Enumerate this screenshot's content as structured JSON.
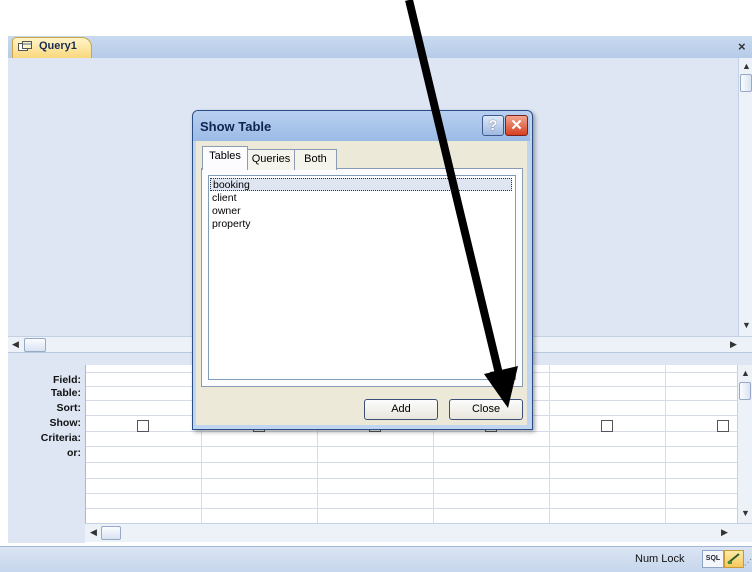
{
  "document": {
    "tab_label": "Query1",
    "close_glyph": "×"
  },
  "grid": {
    "row_labels": [
      "Field:",
      "Table:",
      "Sort:",
      "Show:",
      "Criteria:",
      "or:"
    ]
  },
  "status_bar": {
    "num_lock": "Num Lock",
    "sql_view": "SQL"
  },
  "dialog": {
    "title": "Show Table",
    "help_glyph": "?",
    "close_glyph": "✕",
    "tabs": [
      "Tables",
      "Queries",
      "Both"
    ],
    "active_tab": "Tables",
    "tables": [
      "booking",
      "client",
      "owner",
      "property"
    ],
    "selected_table": "booking",
    "add_label": "Add",
    "close_label": "Close"
  },
  "icons": {
    "arrow": "annotation-arrow",
    "query": "query-icon"
  },
  "colors": {
    "accent": "#d6401f",
    "title": "#0f2450"
  }
}
